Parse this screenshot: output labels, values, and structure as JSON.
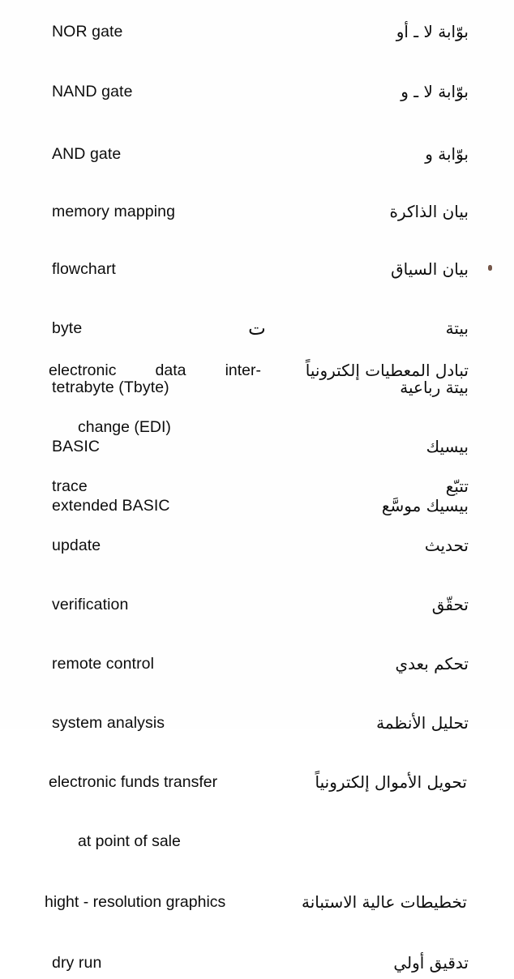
{
  "page": {
    "kind": "scanned-dictionary-page",
    "background_color": "#fefefe",
    "text_color": "#0d0d0d"
  },
  "sections": [
    {
      "heading": "",
      "entries": [
        {
          "en": "NOR gate",
          "ar": "بوّابة لا ـ أو"
        },
        {
          "en": "NAND gate",
          "ar": "بوّابة لا ـ و"
        },
        {
          "en": "AND gate",
          "ar": "بوّابة و"
        },
        {
          "en": "memory mapping",
          "ar": "بيان الذاكرة"
        },
        {
          "en": "flowchart",
          "ar": "بيان السياق"
        },
        {
          "en": "byte",
          "ar": "بيتة"
        },
        {
          "en": "tetrabyte (Tbyte)",
          "ar": "بيتة رباعية"
        },
        {
          "en": "BASIC",
          "ar": "بيسيك"
        },
        {
          "en": "extended BASIC",
          "ar": "بيسيك موسَّع"
        }
      ]
    },
    {
      "heading": "ت",
      "entries": [
        {
          "en": "electronic data inter-",
          "en_cont": "change (EDI)",
          "ar": "تبادل المعطيات إلكترونياً"
        },
        {
          "en": "trace",
          "ar": "تتبّع"
        },
        {
          "en": "update",
          "ar": "تحديث"
        },
        {
          "en": "verification",
          "ar": "تحقّق"
        },
        {
          "en": "remote control",
          "ar": "تحكم بعدي"
        },
        {
          "en": "system analysis",
          "ar": "تحليل الأنظمة"
        },
        {
          "en": "electronic funds transfer",
          "en_cont": "at point of sale",
          "ar": "تحويل الأموال إلكترونياً"
        },
        {
          "en": "hight - resolution graphics",
          "ar": "تخطيطات عالية الاستبانة"
        },
        {
          "en": "dry run",
          "ar": "تدقيق أولي"
        }
      ]
    }
  ]
}
